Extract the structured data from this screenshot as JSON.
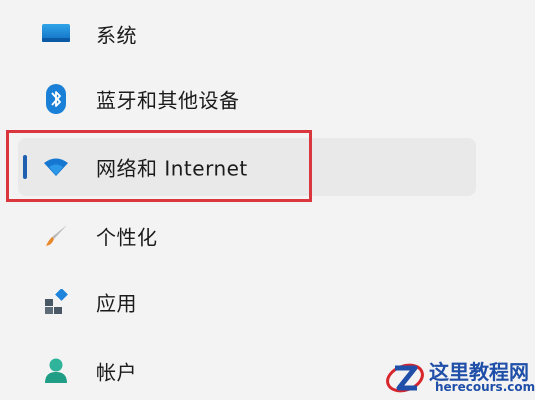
{
  "sidebar": {
    "items": [
      {
        "label": "系统",
        "icon": "monitor-icon"
      },
      {
        "label": "蓝牙和其他设备",
        "icon": "bluetooth-icon"
      },
      {
        "label": "网络和 Internet",
        "icon": "wifi-icon",
        "selected": true
      },
      {
        "label": "个性化",
        "icon": "brush-icon"
      },
      {
        "label": "应用",
        "icon": "apps-icon"
      },
      {
        "label": "帐户",
        "icon": "person-icon"
      }
    ]
  },
  "watermark": {
    "title": "这里教程网",
    "domain": "herecours.com"
  },
  "colors": {
    "accent": "#1f5fb0",
    "highlight": "#d9363e",
    "selected_bg": "#e9e9e9"
  }
}
